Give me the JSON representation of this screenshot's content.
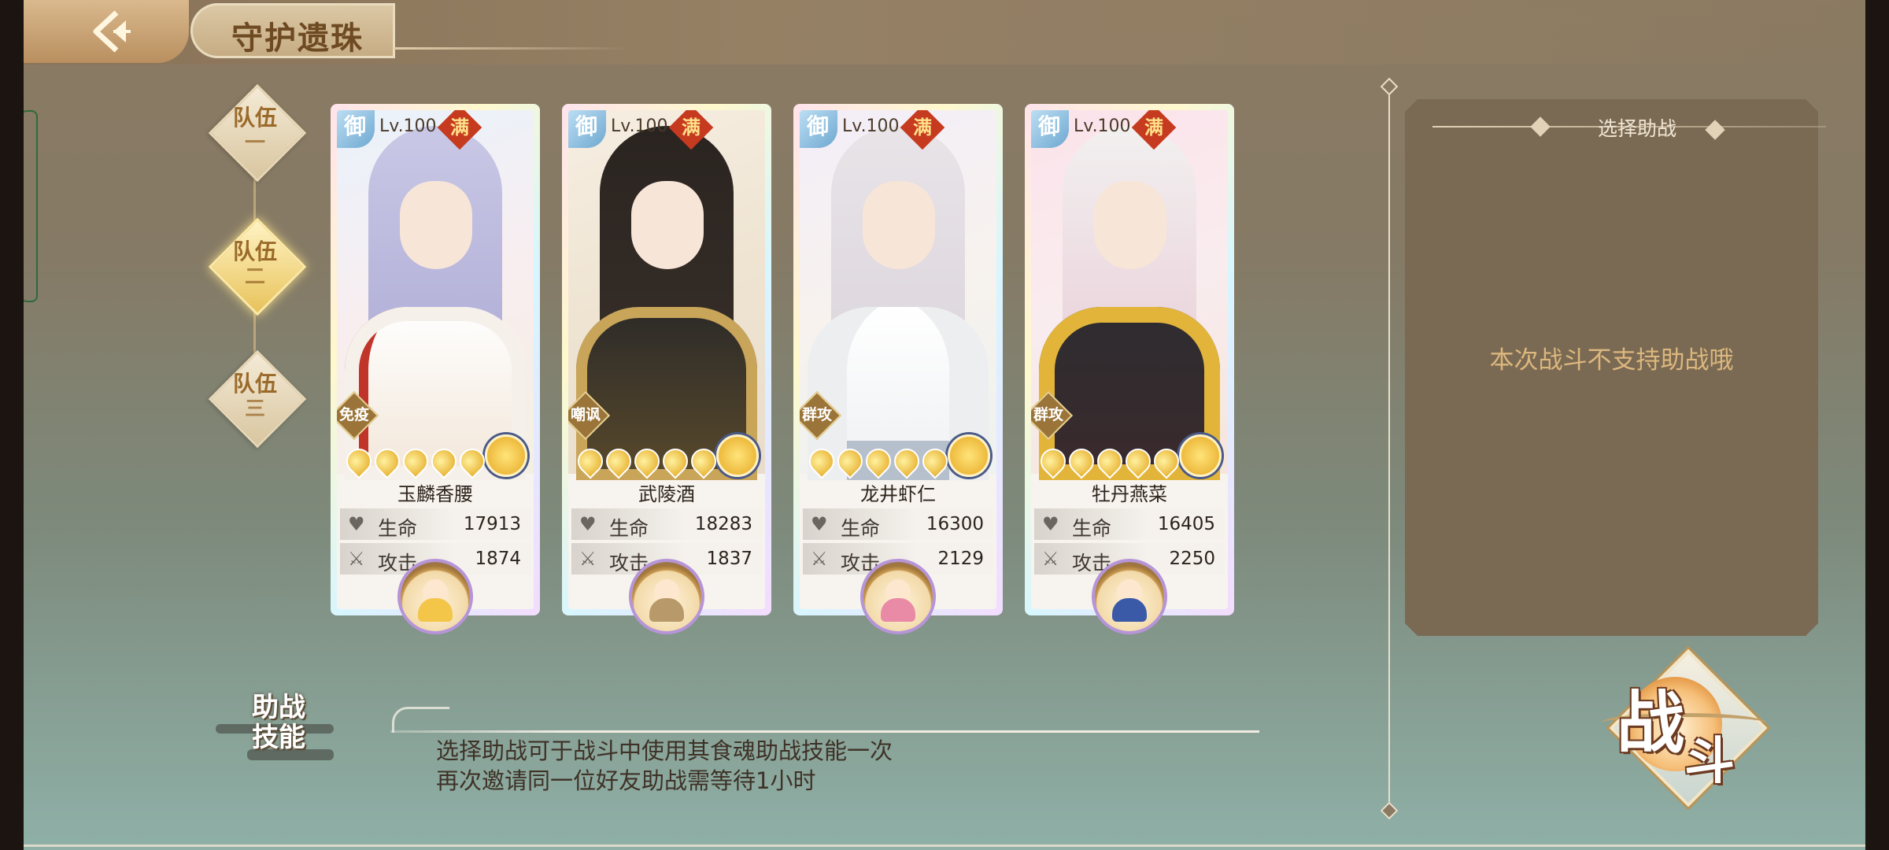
{
  "header": {
    "title": "守护遗珠"
  },
  "teams": [
    {
      "line1": "队伍",
      "line2": "一",
      "active": false
    },
    {
      "line1": "队伍",
      "line2": "二",
      "active": true
    },
    {
      "line1": "队伍",
      "line2": "三",
      "active": false
    }
  ],
  "cards": [
    {
      "badge": "御",
      "level": "Lv.100",
      "max_tag": "满",
      "role": "免疫",
      "name": "玉麟香腰",
      "hp_label": "生命",
      "hp": "17913",
      "atk_label": "攻击",
      "atk": "1874"
    },
    {
      "badge": "御",
      "level": "Lv.100",
      "max_tag": "满",
      "role": "嘲讽",
      "name": "武陵酒",
      "hp_label": "生命",
      "hp": "18283",
      "atk_label": "攻击",
      "atk": "1837"
    },
    {
      "badge": "御",
      "level": "Lv.100",
      "max_tag": "满",
      "role": "群攻",
      "name": "龙井虾仁",
      "hp_label": "生命",
      "hp": "16300",
      "atk_label": "攻击",
      "atk": "2129"
    },
    {
      "badge": "御",
      "level": "Lv.100",
      "max_tag": "满",
      "role": "群攻",
      "name": "牡丹燕菜",
      "hp_label": "生命",
      "hp": "16405",
      "atk_label": "攻击",
      "atk": "2250"
    }
  ],
  "assist_panel": {
    "title": "选择助战",
    "message": "本次战斗不支持助战哦"
  },
  "assist_skill": {
    "badge_line1": "助战",
    "badge_line2": "技能",
    "desc_line1": "选择助战可于战斗中使用其食魂助战技能一次",
    "desc_line2": "再次邀请同一位好友助战需等待1小时"
  },
  "fight": {
    "char1": "战",
    "char2": "斗"
  }
}
